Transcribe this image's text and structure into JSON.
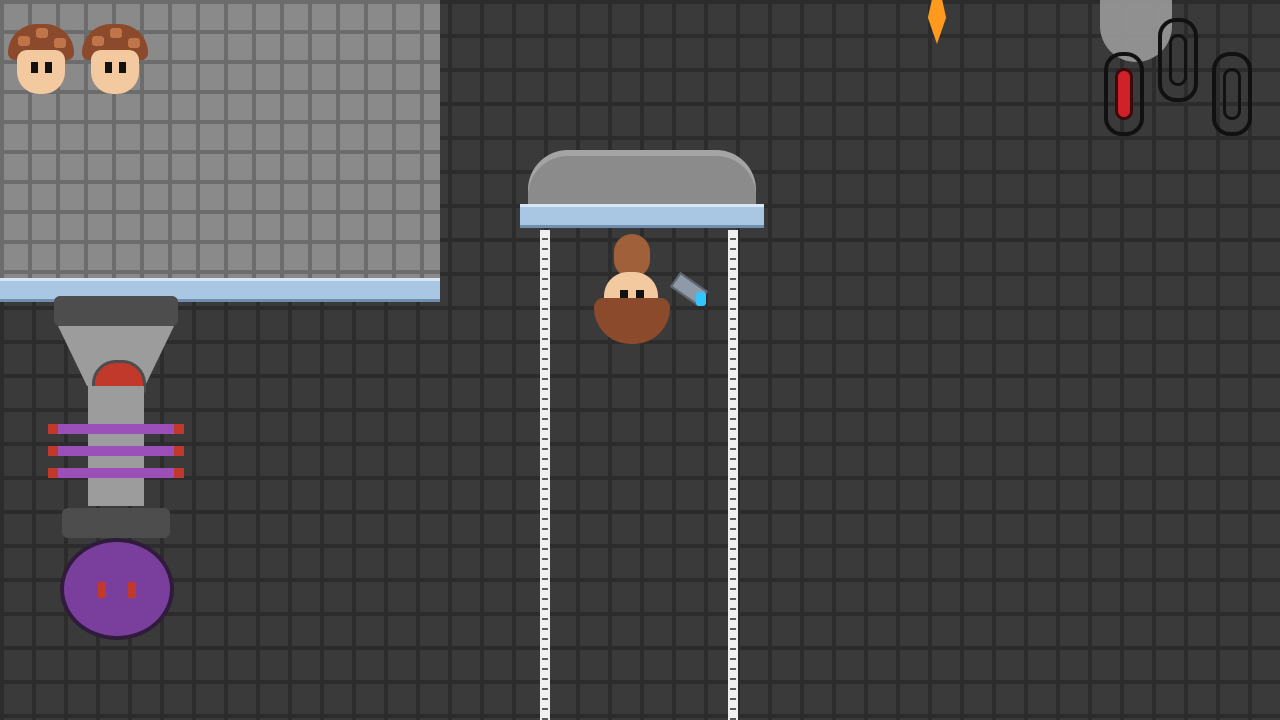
{
  "hud": {
    "lives_remaining": 2,
    "lives_icon": "mushroom-head-icon",
    "gem_slots": 3,
    "gems_collected": 1,
    "gem_icon": "gem-icon",
    "gem_fill_color": "#d0212b"
  },
  "scene": {
    "player": "mushroom-character",
    "player_orientation": "upside-down",
    "player_item": "grapple-gun",
    "hazard_left": "spike-trap-with-purple-orb",
    "platform": "floating-cloud-platform",
    "chains": 2
  },
  "colors": {
    "background_bricks": "#3a3a3a",
    "light_wall": "#8a8a8a",
    "ice_ledge": "#a9c7e3",
    "mushroom_cap": "#8b4a2b",
    "skin": "#f3c9a0",
    "orb_purple": "#7a3f9d",
    "flame": "#ff9a1e"
  }
}
